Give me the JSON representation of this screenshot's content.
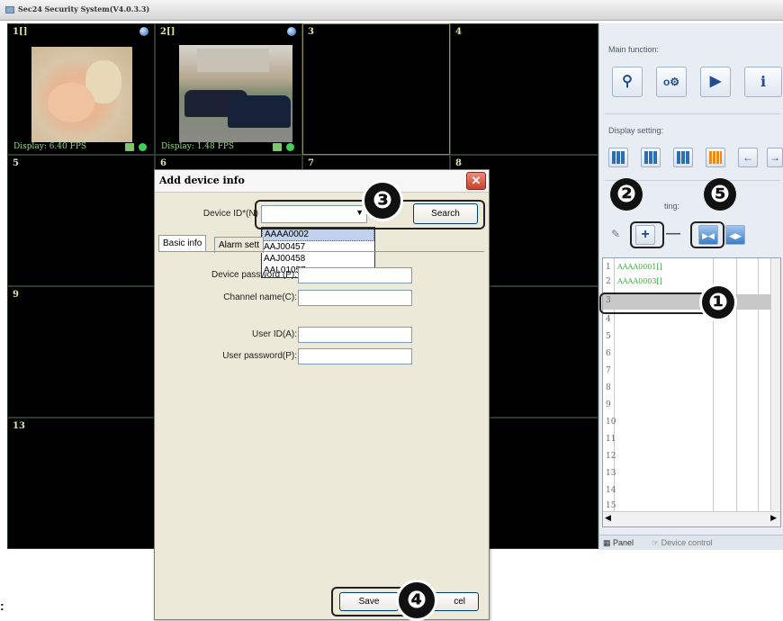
{
  "app": {
    "title": "Sec24 Security System(V4.0.3.3)"
  },
  "grid": {
    "cells": [
      {
        "label": "1[]",
        "status": "Display: 6.40 FPS"
      },
      {
        "label": "2[]",
        "status": "Display: 1.48 FPS"
      },
      {
        "label": "3"
      },
      {
        "label": "4"
      },
      {
        "label": "5"
      },
      {
        "label": "6"
      },
      {
        "label": "7"
      },
      {
        "label": "8"
      },
      {
        "label": "9"
      },
      {
        "label": "13"
      }
    ]
  },
  "panel": {
    "main_function_label": "Main function:",
    "display_setting_label": "Display setting:",
    "device_list_label": "ting:",
    "devices": [
      {
        "index": "1",
        "id": "AAAA0001[]"
      },
      {
        "index": "2",
        "id": "AAAA0003[]"
      },
      {
        "index": "3",
        "id": ""
      }
    ],
    "row_numbers": [
      "4",
      "5",
      "6",
      "7",
      "8",
      "9",
      "10",
      "11",
      "12",
      "13",
      "14",
      "15"
    ],
    "tabs": {
      "panel": "Panel",
      "device_control": "Device control"
    }
  },
  "dialog": {
    "title": "Add device info",
    "device_id_label": "Device ID*(N)",
    "search_button": "Search",
    "dropdown_options": [
      "AAAA0002",
      "AAJ00457",
      "AAJ00458",
      "AAL01057"
    ],
    "tabs": {
      "basic": "Basic info",
      "alarm": "Alarm sett"
    },
    "device_password_label": "Device password (P):",
    "channel_name_label": "Channel name(C):",
    "user_id_label": "User ID(A):",
    "user_password_label": "User password(P):",
    "save_button": "Save",
    "cancel_button": "cel"
  },
  "annotations": {
    "step1": "❶",
    "step2": "❷",
    "step3": "❸",
    "step4": "❹",
    "step5": "❺"
  },
  "page_fragment": ":"
}
